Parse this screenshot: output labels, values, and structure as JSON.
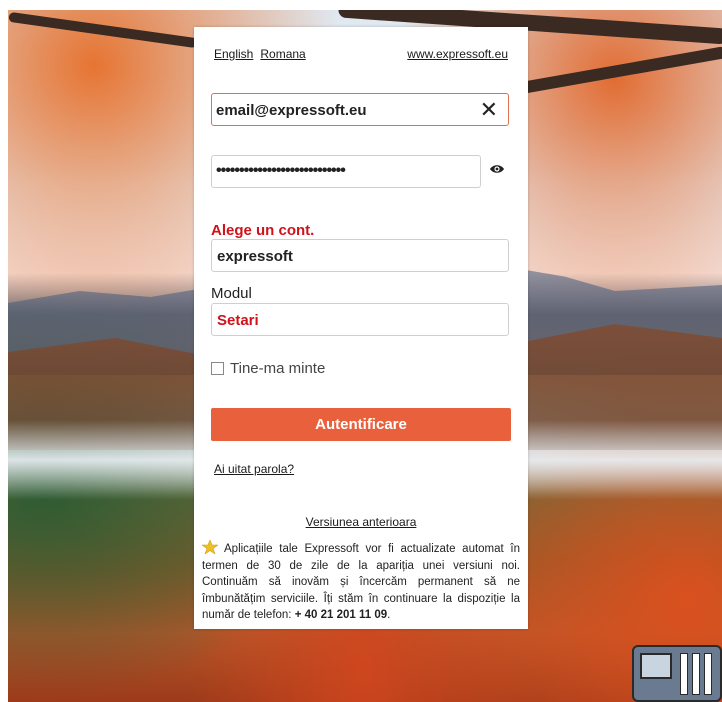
{
  "lang": {
    "english": "English",
    "romana": "Romana"
  },
  "site_link": "www.expressoft.eu",
  "email": {
    "value": "email@expressoft.eu",
    "clear_glyph": "✕"
  },
  "password": {
    "value": "••••••••••••••••••••••••••••"
  },
  "account": {
    "label": "Alege un cont.",
    "value": "expressoft"
  },
  "modul": {
    "label": "Modul",
    "value": "Setari"
  },
  "remember": {
    "label": "Tine-ma minte",
    "checked": false
  },
  "login_button": "Autentificare",
  "forgot_link": "Ai uitat parola?",
  "previous_version_link": "Versiunea anterioara",
  "notice": {
    "text": "Aplicațiile tale Expressoft vor fi actualizate automat în termen de 30 de zile de la apariția unei versiuni noi. Continuăm să inovăm și încercăm permanent să ne îmbunătățim serviciile. Îți stăm în continuare la dispoziție la număr de telefon: ",
    "phone": "+ 40 21 201 11 09",
    "end": "."
  },
  "colors": {
    "accent": "#e8603c",
    "error_red": "#d0121b",
    "email_border": "#e07050"
  },
  "icons": {
    "eye": "eye-icon",
    "clear": "close-icon",
    "star": "star-icon"
  }
}
